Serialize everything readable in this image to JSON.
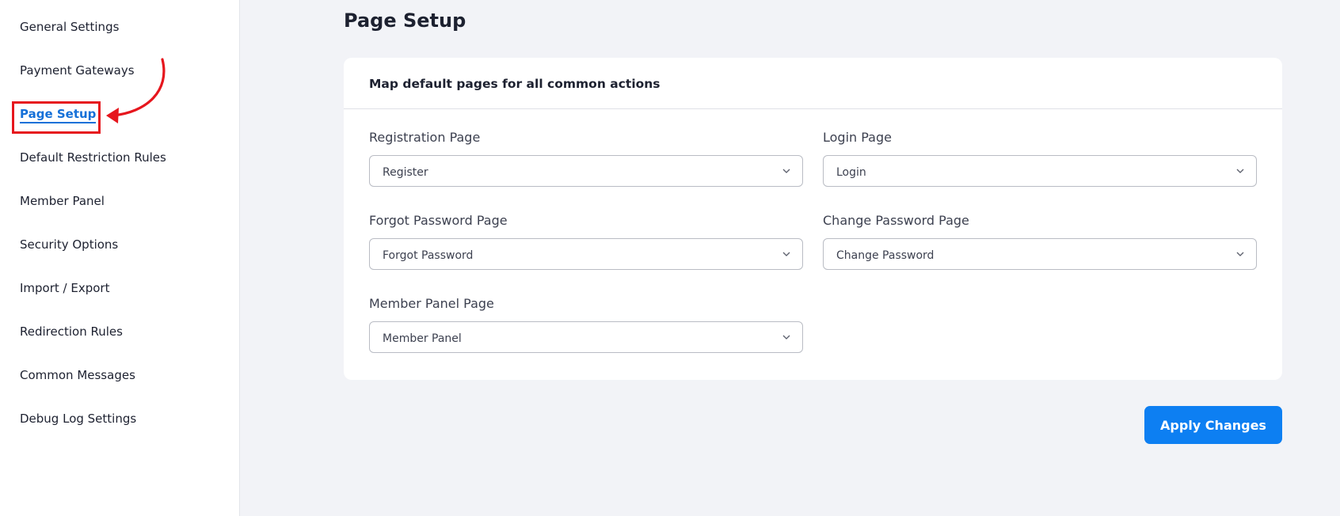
{
  "sidebar": {
    "items": [
      {
        "label": "General Settings",
        "active": false
      },
      {
        "label": "Payment Gateways",
        "active": false
      },
      {
        "label": "Page Setup",
        "active": true
      },
      {
        "label": "Default Restriction Rules",
        "active": false
      },
      {
        "label": "Member Panel",
        "active": false
      },
      {
        "label": "Security Options",
        "active": false
      },
      {
        "label": "Import / Export",
        "active": false
      },
      {
        "label": "Redirection Rules",
        "active": false
      },
      {
        "label": "Common Messages",
        "active": false
      },
      {
        "label": "Debug Log Settings",
        "active": false
      }
    ]
  },
  "page": {
    "title": "Page Setup"
  },
  "card": {
    "title": "Map default pages for all common actions",
    "fields": [
      {
        "label": "Registration Page",
        "value": "Register"
      },
      {
        "label": "Login Page",
        "value": "Login"
      },
      {
        "label": "Forgot Password Page",
        "value": "Forgot Password"
      },
      {
        "label": "Change Password Page",
        "value": "Change Password"
      },
      {
        "label": "Member Panel Page",
        "value": "Member Panel"
      }
    ]
  },
  "actions": {
    "apply_label": "Apply Changes"
  },
  "colors": {
    "accent": "#0d7ff2",
    "active_link": "#1570d8",
    "annotation": "#e6161d",
    "background": "#f2f3f7"
  },
  "icons": {
    "select_chevron": "chevron-down-icon",
    "annotation_arrow": "curved-arrow-icon"
  }
}
